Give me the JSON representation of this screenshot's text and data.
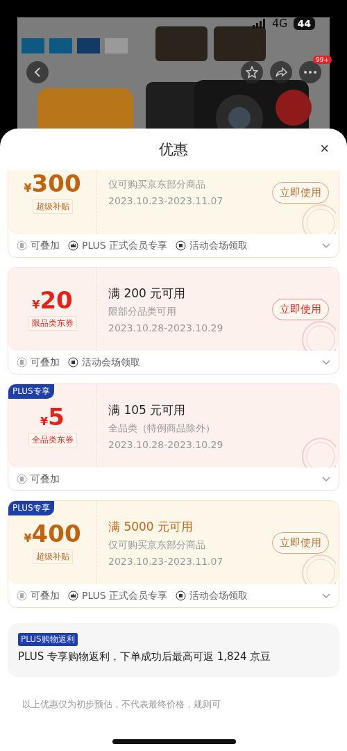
{
  "status_bar": {
    "network": "4G",
    "battery": "44"
  },
  "nav": {
    "more_badge": "99+"
  },
  "sheet": {
    "title": "优惠",
    "close": "×"
  },
  "coupons": [
    {
      "kind": "gold",
      "currency": "¥",
      "amount": "300",
      "tag": "超级补贴",
      "description": "仅可购买京东部分商品",
      "dates": "2023.10.23-2023.11.07",
      "action": "立即使用",
      "features": [
        {
          "kind": "stack",
          "label": "可叠加"
        },
        {
          "kind": "crown",
          "label": "PLUS 正式会员专享"
        },
        {
          "kind": "venue",
          "label": "活动会场领取"
        }
      ]
    },
    {
      "kind": "red",
      "currency": "¥",
      "amount": "20",
      "tag": "限品类东券",
      "title": "满 200 元可用",
      "description": "限部分品类可用",
      "dates": "2023.10.28-2023.10.29",
      "action": "立即使用",
      "features": [
        {
          "kind": "stack",
          "label": "可叠加"
        },
        {
          "kind": "venue",
          "label": "活动会场领取"
        }
      ]
    },
    {
      "kind": "red",
      "badge": "PLUS专享",
      "currency": "¥",
      "amount": "5",
      "tag": "全品类东券",
      "title": "满 105 元可用",
      "description": "全品类（特例商品除外）",
      "dates": "2023.10.28-2023.10.29",
      "features": [
        {
          "kind": "stack",
          "label": "可叠加"
        }
      ]
    },
    {
      "kind": "gold",
      "badge": "PLUS专享",
      "currency": "¥",
      "amount": "400",
      "tag": "超级补贴",
      "title": "满 5000 元可用",
      "description": "仅可购买京东部分商品",
      "dates": "2023.10.23-2023.11.07",
      "action": "立即使用",
      "features": [
        {
          "kind": "stack",
          "label": "可叠加"
        },
        {
          "kind": "crown",
          "label": "PLUS 正式会员专享"
        },
        {
          "kind": "venue",
          "label": "活动会场领取"
        }
      ]
    }
  ],
  "rebate": {
    "badge": "PLUS购物返利",
    "text": "PLUS 专享购物返利，下单成功后最高可返 1,824 京豆"
  },
  "disclaimer": "以上优惠仅为初步预估，不代表最终价格，规则可"
}
